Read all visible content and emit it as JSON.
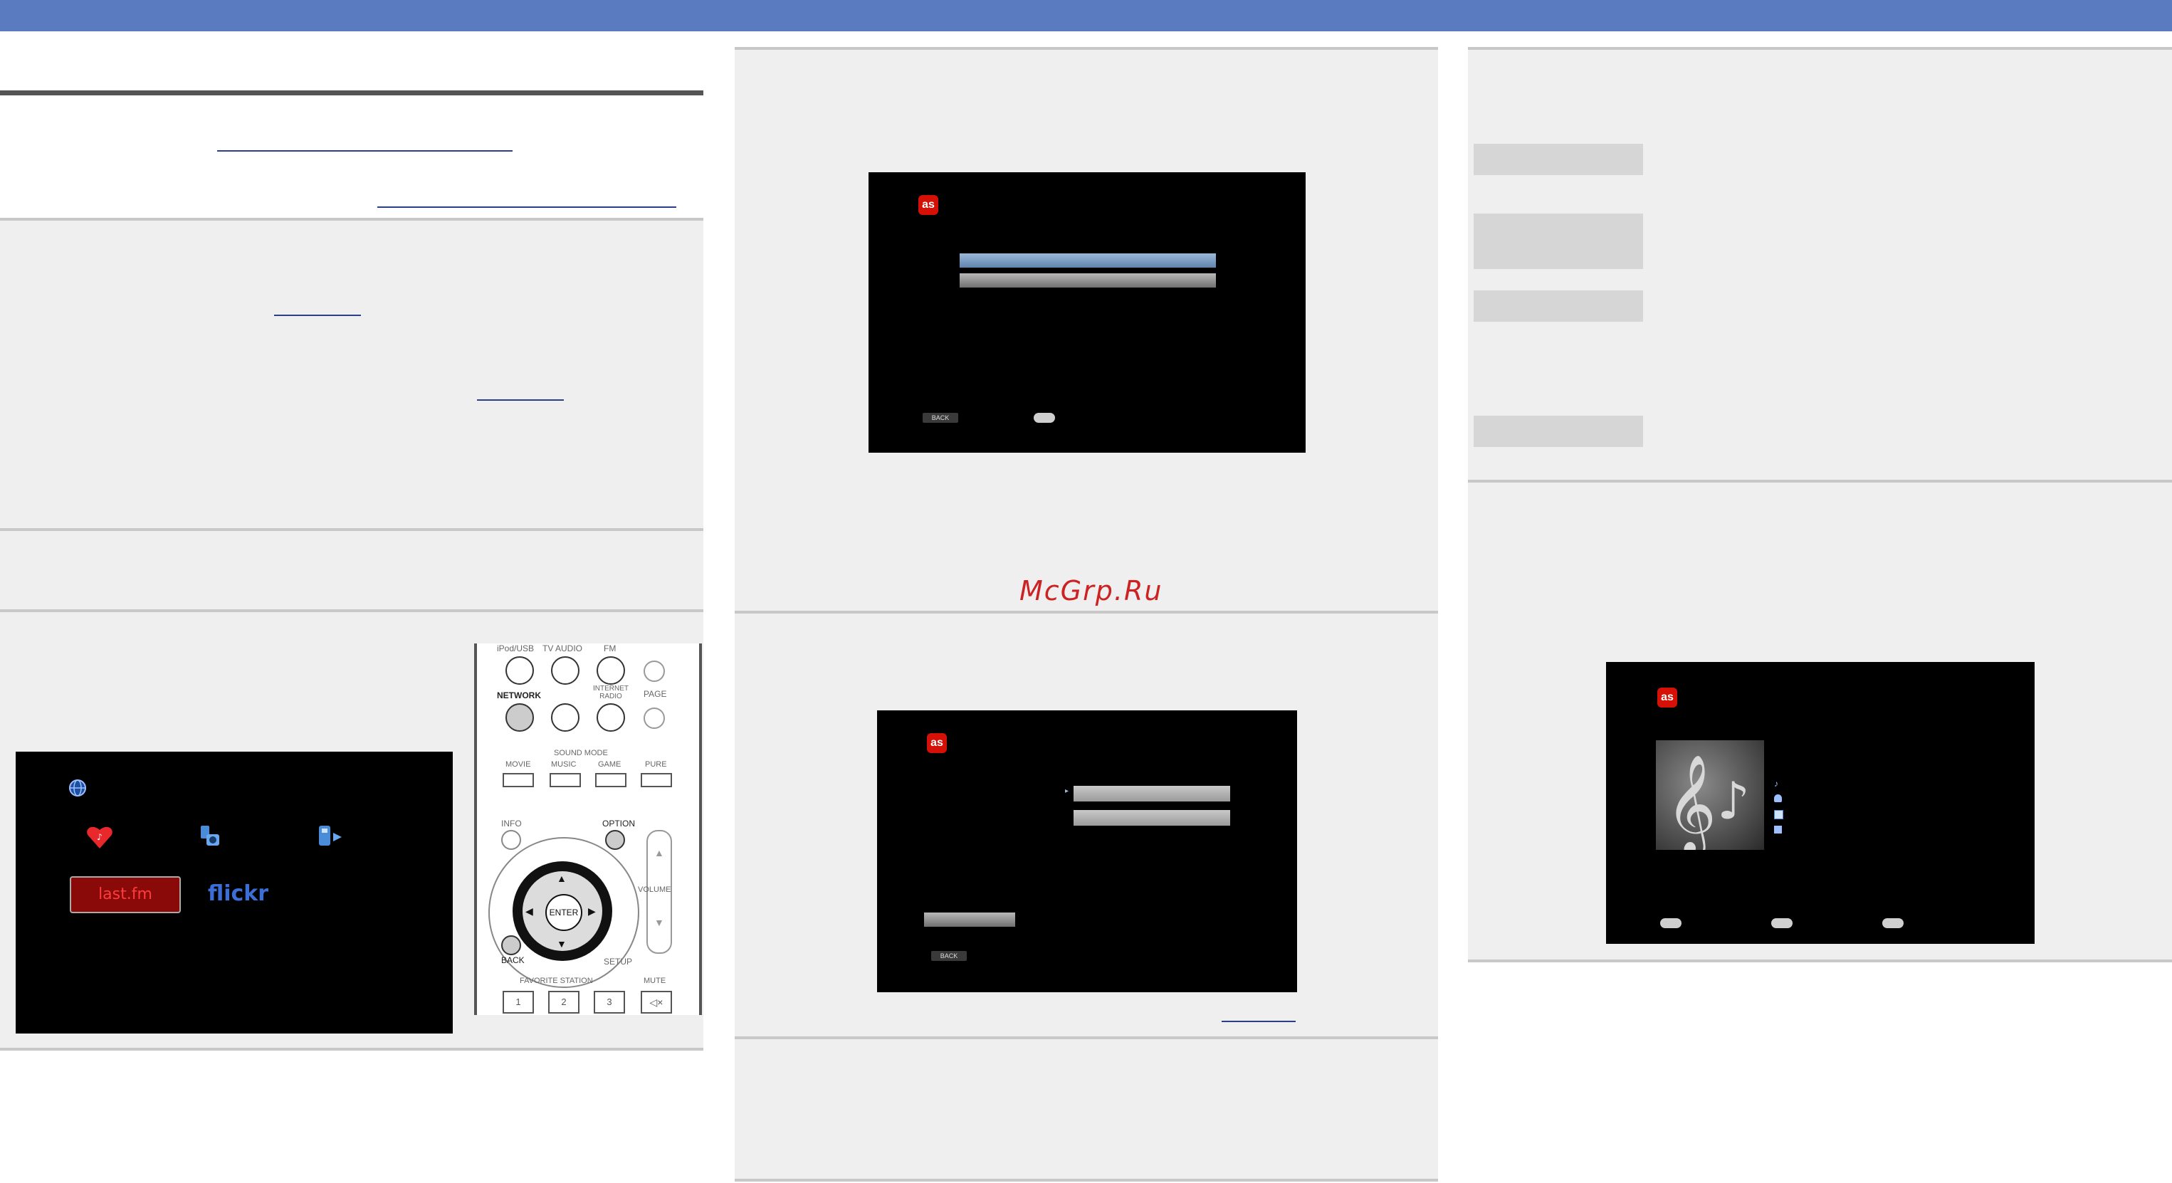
{
  "watermark": "McGrp.Ru",
  "lastfm_screen": {
    "logo": "as",
    "back_label": "BACK"
  },
  "network_menu": {
    "lastfm_label": "last.fm",
    "flickr_label": "flickr"
  },
  "remote": {
    "row1_labels": [
      "iPod/USB",
      "TV AUDIO",
      "FM"
    ],
    "network": "NETWORK",
    "internet_radio": "INTERNET RADIO",
    "page": "PAGE",
    "sound_mode": "SOUND MODE",
    "sound_mode_buttons": [
      "MOVIE",
      "MUSIC",
      "GAME",
      "PURE"
    ],
    "info": "INFO",
    "option": "OPTION",
    "enter": "ENTER",
    "back": "BACK",
    "setup": "SETUP",
    "volume": "VOLUME",
    "favorite_station": "FAVORITE STATION",
    "mute": "MUTE",
    "station_numbers": [
      "1",
      "2",
      "3"
    ]
  },
  "colors": {
    "header": "#5b7bc0",
    "lastfm_red": "#d51007",
    "flickr_blue": "#0063dc",
    "flickr_pink": "#ff0084"
  }
}
